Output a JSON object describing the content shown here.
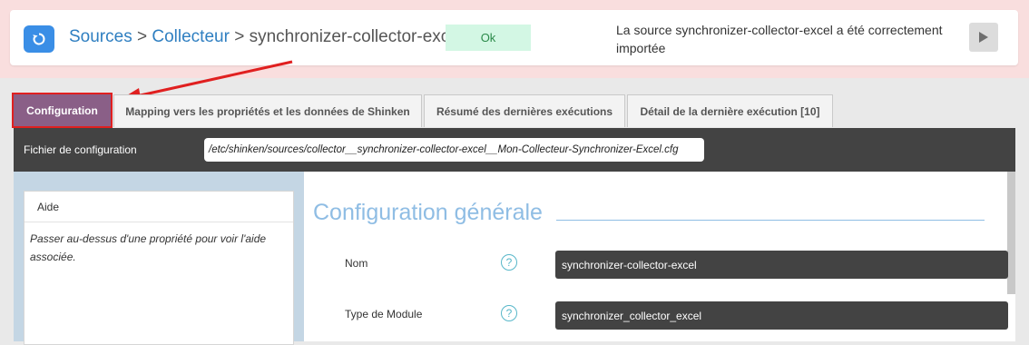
{
  "header": {
    "breadcrumb": {
      "sources": "Sources",
      "sep1": ">",
      "collecteur": "Collecteur",
      "sep2": ">",
      "current": "synchronizer-collector-excel"
    },
    "status_label": "Ok",
    "message": "La source synchronizer-collector-excel a été correctement importée",
    "back_icon": "refresh-icon",
    "play_icon": "play-icon"
  },
  "tabs": [
    {
      "label": "Configuration",
      "active": true
    },
    {
      "label": "Mapping vers les propriétés et les données de Shinken",
      "active": false
    },
    {
      "label": "Résumé des dernières exécutions",
      "active": false
    },
    {
      "label": "Détail de la dernière exécution [10]",
      "active": false
    }
  ],
  "config_file": {
    "label": "Fichier de configuration",
    "path": "/etc/shinken/sources/collector__synchronizer-collector-excel__Mon-Collecteur-Synchronizer-Excel.cfg"
  },
  "help": {
    "title": "Aide",
    "text": "Passer au-dessus d'une propriété pour voir l'aide associée."
  },
  "general": {
    "title": "Configuration générale",
    "properties": [
      {
        "label": "Nom",
        "value": "synchronizer-collector-excel"
      },
      {
        "label": "Type de Module",
        "value": "synchronizer_collector_excel"
      }
    ]
  },
  "colors": {
    "accent": "#3a8ee6",
    "active_tab": "#8a5f87",
    "highlight": "#e02020",
    "status_ok_bg": "#d3f7e4"
  }
}
